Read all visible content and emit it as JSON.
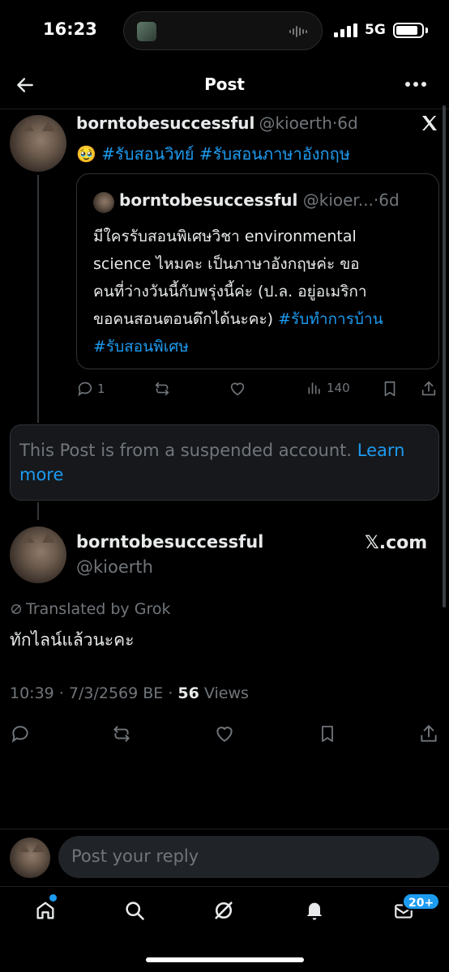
{
  "status_bar": {
    "time": "16:23",
    "network": "5G"
  },
  "header": {
    "title": "Post"
  },
  "thread_post": {
    "name": "borntobesuccessful",
    "handle": "@kioerth",
    "age": "6d",
    "emoji": "🥹",
    "hashtags": [
      "#รับสอนวิทย์",
      "#รับสอนภาษาอังกฤษ"
    ],
    "quote": {
      "name": "borntobesuccessful",
      "handle": "@kioer...",
      "age": "6d",
      "lines": [
        "มีใครรับสอนพิเศษวิชา environmental",
        "science ไหมคะ เป็นภาษาอังกฤษค่ะ ขอ",
        "คนที่ว่างวันนี้กับพรุ่งนี้ค่ะ (ป.ล. อยู่อเมริกา",
        "ขอคนสอนตอนดึกได้นะคะ)"
      ],
      "hashtags": [
        "#รับทำการบ้าน",
        "#รับสอนพิเศษ"
      ]
    },
    "replies": "1",
    "views": "140"
  },
  "suspended_notice": {
    "text": "This Post is from a suspended account.",
    "link": "Learn more"
  },
  "main_post": {
    "name": "borntobesuccessful",
    "handle": "@kioerth",
    "source": "𝕏.com",
    "translated_by": "Translated by Grok",
    "text": "ทักไลน์แล้วนะคะ",
    "timestamp": "10:39 · 7/3/2569 BE · ",
    "view_count": "56",
    "views_label": " Views"
  },
  "reply": {
    "placeholder": "Post your reply"
  },
  "bottom_nav": {
    "messages_badge": "20+"
  },
  "colors": {
    "accent": "#1d9bf0",
    "background": "#000000",
    "muted": "#71767b"
  }
}
